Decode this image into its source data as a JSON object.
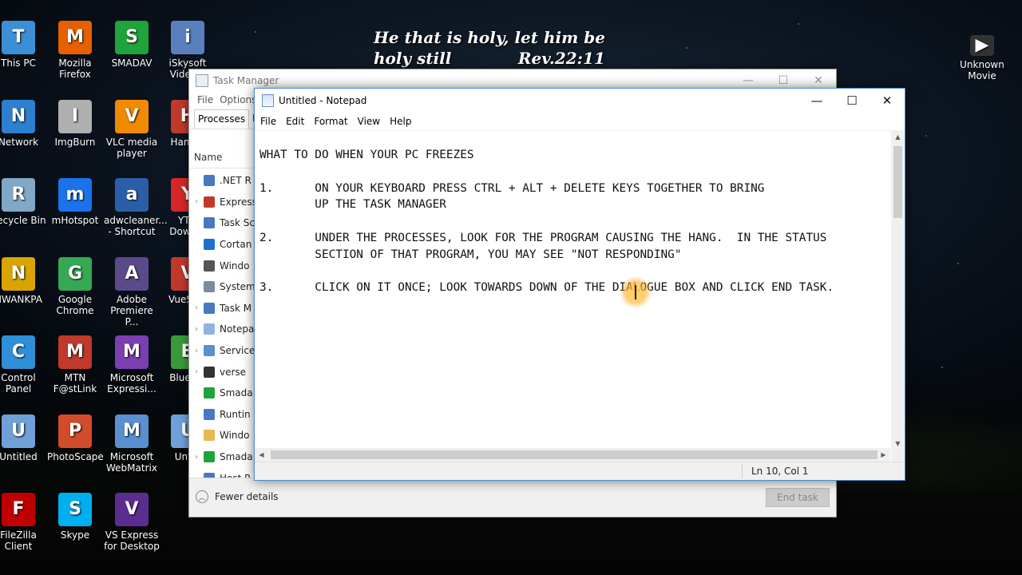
{
  "wallpaper": {
    "verse_line1": "He that is holy, let him be",
    "verse_line2": "holy still            Rev.22:11"
  },
  "desktop_icons": [
    {
      "label": "This PC",
      "icon": "computer-icon",
      "color": "#3b8fd6"
    },
    {
      "label": "Mozilla Firefox",
      "icon": "firefox-icon",
      "color": "#e66000"
    },
    {
      "label": "SMADAV",
      "icon": "smadav-icon",
      "color": "#1fa33a"
    },
    {
      "label": "iSkysoft Video...",
      "icon": "iskysoft-icon",
      "color": "#5a7fbf"
    },
    {
      "label": "Network",
      "icon": "network-icon",
      "color": "#2d7fd0"
    },
    {
      "label": "ImgBurn",
      "icon": "imgburn-icon",
      "color": "#b0b0b0"
    },
    {
      "label": "VLC media player",
      "icon": "vlc-icon",
      "color": "#f08a00"
    },
    {
      "label": "Hand...",
      "icon": "handbrake-icon",
      "color": "#c0392b"
    },
    {
      "label": "Recycle Bin",
      "icon": "recycle-bin-icon",
      "color": "#7fa8c9"
    },
    {
      "label": "mHotspot",
      "icon": "wifi-icon",
      "color": "#1a73e8"
    },
    {
      "label": "adwcleaner... - Shortcut",
      "icon": "adwcleaner-icon",
      "color": "#2a5fa8"
    },
    {
      "label": "YTD Down...",
      "icon": "ytd-icon",
      "color": "#d62828"
    },
    {
      "label": "NWANKPA",
      "icon": "user-folder-icon",
      "color": "#d9a400"
    },
    {
      "label": "Google Chrome",
      "icon": "chrome-icon",
      "color": "#34a853"
    },
    {
      "label": "Adobe Premiere P...",
      "icon": "premiere-icon",
      "color": "#5a4a8a"
    },
    {
      "label": "VueSc...",
      "icon": "vuescan-icon",
      "color": "#c0392b"
    },
    {
      "label": "Control Panel",
      "icon": "control-panel-icon",
      "color": "#2f8fd8"
    },
    {
      "label": "MTN F@stLink",
      "icon": "mtn-icon",
      "color": "#c0392b"
    },
    {
      "label": "Microsoft Expressi...",
      "icon": "expression-icon",
      "color": "#7a3fb0"
    },
    {
      "label": "BlueS...",
      "icon": "bluestacks-icon",
      "color": "#3a9a3a"
    },
    {
      "label": "Untitled",
      "icon": "untitled-file-icon",
      "color": "#6fa0d8"
    },
    {
      "label": "PhotoScape",
      "icon": "photoscape-icon",
      "color": "#d24b2a"
    },
    {
      "label": "Microsoft WebMatrix",
      "icon": "webmatrix-icon",
      "color": "#5a8fd0"
    },
    {
      "label": "Unt...",
      "icon": "untitled-file-icon",
      "color": "#6fa0d8"
    },
    {
      "label": "FileZilla Client",
      "icon": "filezilla-icon",
      "color": "#bf0000"
    },
    {
      "label": "Skype",
      "icon": "skype-icon",
      "color": "#00aff0"
    },
    {
      "label": "VS Express for Desktop",
      "icon": "visual-studio-icon",
      "color": "#5b2d90"
    }
  ],
  "right_icon": {
    "label": "Unknown Movie",
    "icon": "movie-file-icon"
  },
  "task_manager": {
    "title": "Task Manager",
    "menu": [
      "File",
      "Options"
    ],
    "tabs": [
      "Processes",
      "Pe"
    ],
    "column_name": "Name",
    "processes": [
      {
        "name": ".NET R",
        "expandable": false,
        "icon_color": "#4a78c0"
      },
      {
        "name": "Express",
        "expandable": true,
        "icon_color": "#c0392b"
      },
      {
        "name": "Task Sc",
        "expandable": false,
        "icon_color": "#4a78c0"
      },
      {
        "name": "Cortan",
        "expandable": false,
        "icon_color": "#1f6fd0"
      },
      {
        "name": "Windo",
        "expandable": false,
        "icon_color": "#555555"
      },
      {
        "name": "System",
        "expandable": false,
        "icon_color": "#7a8aa0"
      },
      {
        "name": "Task M",
        "expandable": true,
        "icon_color": "#4a78c0"
      },
      {
        "name": "Notepa",
        "expandable": true,
        "icon_color": "#8fb3e0"
      },
      {
        "name": "Service",
        "expandable": true,
        "icon_color": "#5a8fd0"
      },
      {
        "name": "verse",
        "expandable": true,
        "icon_color": "#333333"
      },
      {
        "name": "Smada",
        "expandable": false,
        "icon_color": "#1fa33a"
      },
      {
        "name": "Runtin",
        "expandable": false,
        "icon_color": "#4a78c0"
      },
      {
        "name": "Windo",
        "expandable": false,
        "icon_color": "#e8b84a"
      },
      {
        "name": "Smada",
        "expandable": true,
        "icon_color": "#1fa33a"
      },
      {
        "name": "Host P",
        "expandable": false,
        "icon_color": "#4a78c0"
      }
    ],
    "fewer_details": "Fewer details",
    "end_task": "End task",
    "controls": {
      "minimize": "—",
      "maximize": "☐",
      "close": "✕"
    }
  },
  "notepad": {
    "title": "Untitled - Notepad",
    "menu": [
      "File",
      "Edit",
      "Format",
      "View",
      "Help"
    ],
    "controls": {
      "minimize": "—",
      "maximize": "☐",
      "close": "✕"
    },
    "lines": [
      "WHAT TO DO WHEN YOUR PC FREEZES",
      "",
      "1.      ON YOUR KEYBOARD PRESS CTRL + ALT + DELETE KEYS TOGETHER TO BRING",
      "        UP THE TASK MANAGER",
      "",
      "2.      UNDER THE PROCESSES, LOOK FOR THE PROGRAM CAUSING THE HANG.  IN THE STATUS",
      "        SECTION OF THAT PROGRAM, YOU MAY SEE \"NOT RESPONDING\"",
      "",
      "3.      CLICK ON IT ONCE; LOOK TOWARDS DOWN OF THE DIALOGUE BOX AND CLICK END TASK."
    ],
    "status_position": "Ln 10, Col 1"
  }
}
